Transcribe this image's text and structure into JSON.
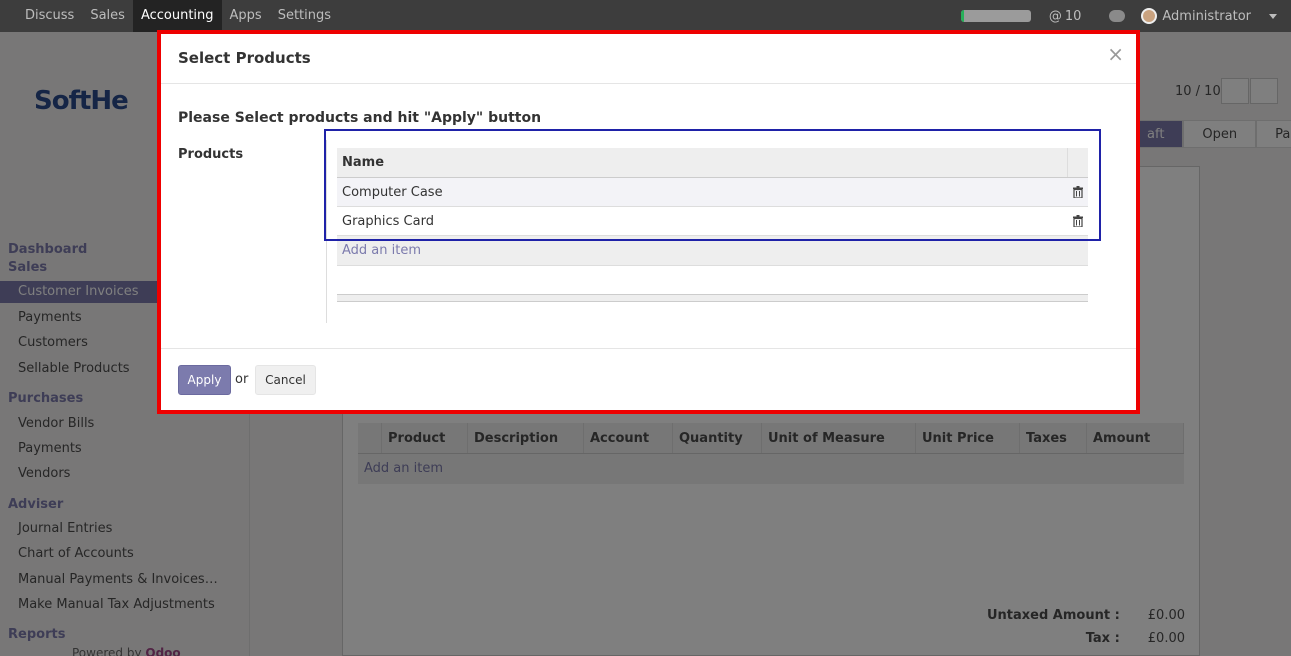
{
  "navbar": {
    "menu": [
      "Discuss",
      "Sales",
      "Accounting",
      "Apps",
      "Settings"
    ],
    "active": "Accounting",
    "progress": 0.05,
    "progress_color": "#27b05a",
    "messages_count": "10",
    "user": "Administrator"
  },
  "sidebar": {
    "logo": "SoftHe",
    "sections": [
      {
        "heading": "Dashboard"
      },
      {
        "heading": "Sales",
        "items": [
          "Customer Invoices",
          "Payments",
          "Customers",
          "Sellable Products"
        ]
      },
      {
        "heading": "Purchases",
        "items": [
          "Vendor Bills",
          "Payments",
          "Vendors"
        ]
      },
      {
        "heading": "Adviser",
        "items": [
          "Journal Entries",
          "Chart of Accounts",
          "Manual Payments & Invoices…",
          "Make Manual Tax Adjustments"
        ]
      },
      {
        "heading": "Reports"
      }
    ],
    "active_item": "Customer Invoices",
    "powered_by": "Powered by",
    "powered_brand": "Odoo"
  },
  "background": {
    "pager": "10 / 10",
    "statuses": [
      "aft",
      "Open",
      "Paid"
    ],
    "line_columns": [
      "Product",
      "Description",
      "Account",
      "Quantity",
      "Unit of Measure",
      "Unit Price",
      "Taxes",
      "Amount"
    ],
    "add_item": "Add an item",
    "untaxed_label": "Untaxed Amount :",
    "untaxed_value": "£0.00",
    "tax_label": "Tax :",
    "tax_value": "£0.00"
  },
  "modal": {
    "title": "Select Products",
    "close": "×",
    "instruction": "Please Select products and hit \"Apply\" button",
    "products_label": "Products",
    "column_name": "Name",
    "products": [
      "Computer Case",
      "Graphics Card"
    ],
    "add_item": "Add an item",
    "apply_label": "Apply",
    "or_label": "or",
    "cancel_label": "Cancel"
  },
  "colors": {
    "accent": "#7c7bad",
    "highlight_red": "#ee0000",
    "highlight_blue": "#1f22a8"
  }
}
